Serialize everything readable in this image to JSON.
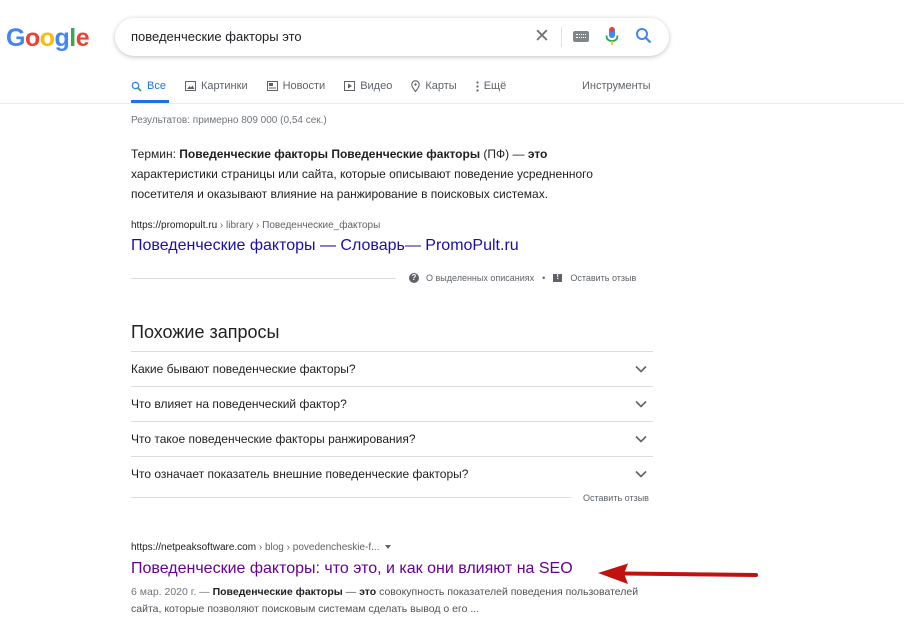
{
  "logo": [
    "G",
    "o",
    "o",
    "g",
    "l",
    "e"
  ],
  "search": {
    "query": "поведенческие факторы это",
    "clear_icon": "✕"
  },
  "tabs": [
    {
      "label": "Все",
      "icon": "search-icon",
      "active": true
    },
    {
      "label": "Картинки",
      "icon": "image-icon"
    },
    {
      "label": "Новости",
      "icon": "news-icon"
    },
    {
      "label": "Видео",
      "icon": "play-icon"
    },
    {
      "label": "Карты",
      "icon": "pin-icon"
    },
    {
      "label": "Ещё",
      "icon": "more-vert-icon"
    }
  ],
  "tools_label": "Инструменты",
  "stats": "Результатов: примерно 809 000 (0,54 сек.)",
  "featured": {
    "parts": [
      {
        "t": "Термин: ",
        "b": false
      },
      {
        "t": "Поведенческие факторы Поведенческие факторы",
        "b": true
      },
      {
        "t": " (ПФ) — ",
        "b": false
      },
      {
        "t": "это",
        "b": true
      },
      {
        "t": " характеристики страницы или сайта, которые описывают поведение усредненного посетителя и оказывают влияние на ранжирование в поисковых системах.",
        "b": false
      }
    ],
    "cite_domain": "https://promopult.ru",
    "cite_path": " › library › Поведенческие_факторы",
    "title": "Поведенческие факторы — Словарь— PromoPult.ru",
    "about_label": "О выделенных описаниях",
    "dot": "•",
    "feedback_label": "Оставить отзыв"
  },
  "related": {
    "title": "Похожие запросы",
    "items": [
      "Какие бывают поведенческие факторы?",
      "Что влияет на поведенческий фактор?",
      "Что такое поведенческие факторы ранжирования?",
      "Что означает показатель внешние поведенческие факторы?"
    ],
    "feedback_label": "Оставить отзыв"
  },
  "result": {
    "cite_domain": "https://netpeaksoftware.com",
    "cite_path": " › blog › povedencheskie-f...",
    "title": "Поведенческие факторы: что это, и как они влияют на SEO",
    "date": "6 мар. 2020 г. — ",
    "snippet_bold1": "Поведенческие факторы",
    "snippet_mid": " — ",
    "snippet_bold2": "это",
    "snippet_rest": " совокупность показателей поведения пользователей сайта, которые позволяют поисковым системам сделать вывод о его ..."
  },
  "colors": {
    "link": "#1a0dab",
    "visited": "#660099",
    "accent": "#1a73e8",
    "arrow": "#c0120f"
  }
}
